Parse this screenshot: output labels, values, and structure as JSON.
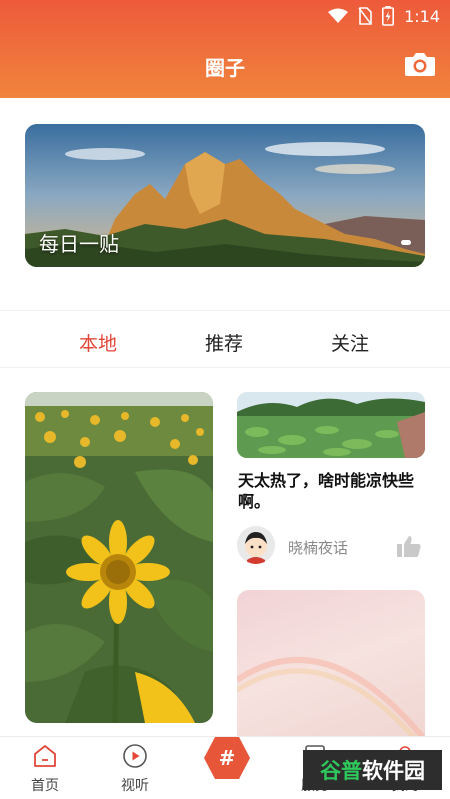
{
  "status_bar": {
    "time": "1:14"
  },
  "header": {
    "title": "圈子"
  },
  "banner": {
    "label": "每日一贴"
  },
  "tabs": [
    {
      "label": "本地",
      "active": true
    },
    {
      "label": "推荐",
      "active": false
    },
    {
      "label": "关注",
      "active": false
    }
  ],
  "feed": {
    "post": {
      "title": "天太热了，啥时能凉快些啊。",
      "author": "晓楠夜话"
    }
  },
  "bottom_nav": {
    "items": [
      {
        "label": "首页",
        "icon": "home-icon"
      },
      {
        "label": "视听",
        "icon": "play-icon"
      },
      {
        "label": "#",
        "icon": "hash-icon"
      },
      {
        "label": "服务",
        "icon": "service-icon"
      },
      {
        "label": "我的",
        "icon": "profile-icon"
      }
    ]
  },
  "watermark": {
    "text_a": "谷普",
    "text_b": "软件园"
  },
  "colors": {
    "accent": "#e2473a",
    "header_top": "#ee5a3b",
    "header_bottom": "#f0843c"
  }
}
